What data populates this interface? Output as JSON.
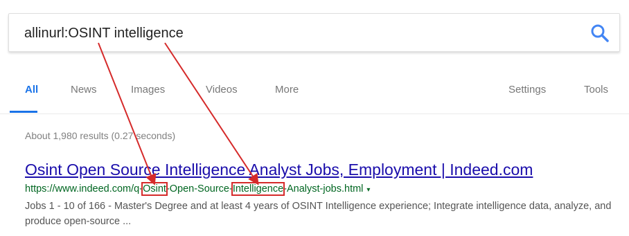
{
  "search": {
    "query": "allinurl:OSINT intelligence",
    "icon": "search-icon",
    "accent": "#4285f4"
  },
  "tabs": [
    {
      "label": "All",
      "active": true
    },
    {
      "label": "News"
    },
    {
      "label": "Images"
    },
    {
      "label": "Videos"
    },
    {
      "label": "More"
    },
    {
      "label": "Settings"
    },
    {
      "label": "Tools"
    }
  ],
  "results_stats": "About 1,980 results (0.27 seconds)",
  "result": {
    "title": "Osint Open Source Intelligence Analyst Jobs, Employment | Indeed.com",
    "url_parts": {
      "prefix": "https://www.indeed.com/q-",
      "hl1": "Osint",
      "middle": "-Open-Source-",
      "hl2": "Intelligence",
      "suffix": "-Analyst-jobs.html"
    },
    "url_menu": "▾",
    "snippet": "Jobs 1 - 10 of 166 - Master's Degree and at least 4 years of OSINT Intelligence experience; Integrate intelligence data, analyze, and produce open-source ..."
  },
  "colors": {
    "title_link": "#1a0dab",
    "url_green": "#006621",
    "annotation_red": "#d52a2a",
    "active_tab": "#1a73e8"
  }
}
